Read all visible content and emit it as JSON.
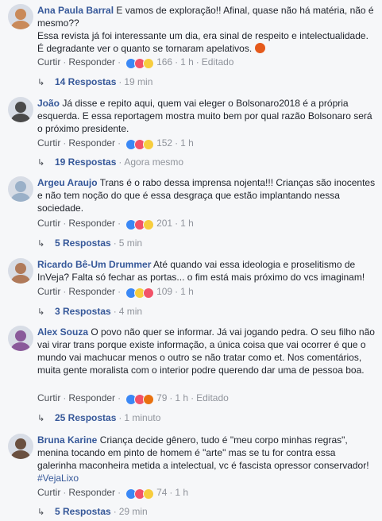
{
  "comments": [
    {
      "author": "Ana Paula Barral",
      "text": "E vamos de exploração!! Afinal, quase não há matéria, não é mesmo??\nEssa revista já foi interessante um dia, era sinal de respeito e intelectualidade. É degradante ver o quanto se tornaram apelativos.",
      "emoji": "angry-face-emoji",
      "actions": {
        "curtir": "Curtir",
        "responder": "Responder",
        "count": "166",
        "time": "1 h",
        "edited": "Editado"
      },
      "reactions": [
        "like",
        "love",
        "haha"
      ],
      "replies": {
        "label": "14 Respostas",
        "time": "19 min"
      },
      "avatar_color": "#c98a5a"
    },
    {
      "author": "João",
      "text": "Já disse e repito aqui, quem vai eleger o Bolsonaro2018 é a própria esquerda. E essa reportagem mostra muito bem por qual razão Bolsonaro será o próximo presidente.",
      "actions": {
        "curtir": "Curtir",
        "responder": "Responder",
        "count": "152",
        "time": "1 h"
      },
      "reactions": [
        "like",
        "love",
        "haha"
      ],
      "replies": {
        "label": "19 Respostas",
        "time": "Agora mesmo"
      },
      "avatar_color": "#4a4a4a"
    },
    {
      "author": "Argeu Araujo",
      "text": "Trans é o rabo dessa imprensa nojenta!!! Crianças são inocentes e não tem noção do que é essa desgraça que estão implantando nessa sociedade.",
      "actions": {
        "curtir": "Curtir",
        "responder": "Responder",
        "count": "201",
        "time": "1 h"
      },
      "reactions": [
        "like",
        "love",
        "haha"
      ],
      "replies": {
        "label": "5 Respostas",
        "time": "5 min"
      },
      "avatar_color": "#9ab0c8"
    },
    {
      "author": "Ricardo Bê-Um Drummer",
      "text": "Até quando vai essa ideologia e proselitismo de InVeja? Falta só fechar as portas... o fim está mais próximo do vcs imaginam!",
      "actions": {
        "curtir": "Curtir",
        "responder": "Responder",
        "count": "109",
        "time": "1 h"
      },
      "reactions": [
        "like",
        "haha",
        "love"
      ],
      "replies": {
        "label": "3 Respostas",
        "time": "4 min"
      },
      "avatar_color": "#b07a5a"
    },
    {
      "author": "Alex Souza",
      "text": "O povo não quer se informar. Já vai jogando pedra. O seu filho não vai virar trans porque existe informação, a única coisa que vai ocorrer é que o mundo vai machucar menos o outro se não tratar como et. Nos comentários, muita gente moralista com o interior podre querendo dar uma de pessoa boa.",
      "actions": {
        "curtir": "Curtir",
        "responder": "Responder",
        "count": "79",
        "time": "1 h",
        "edited": "Editado"
      },
      "reactions": [
        "like",
        "love",
        "angry"
      ],
      "replies": {
        "label": "25 Respostas",
        "time": "1 minuto"
      },
      "avatar_color": "#8a5a9a"
    },
    {
      "author": "Bruna Karine",
      "text": "Criança decide gênero, tudo é \"meu corpo minhas regras\", menina tocando em pinto de homem é \"arte\" mas se tu for contra essa galerinha maconheira metida a intelectual, vc é fascista opressor conservador!",
      "hashtag": "#VejaLixo",
      "actions": {
        "curtir": "Curtir",
        "responder": "Responder",
        "count": "74",
        "time": "1 h"
      },
      "reactions": [
        "like",
        "love",
        "haha"
      ],
      "replies": {
        "label": "5 Respostas",
        "time": "29 min"
      },
      "avatar_color": "#6a5040"
    }
  ]
}
